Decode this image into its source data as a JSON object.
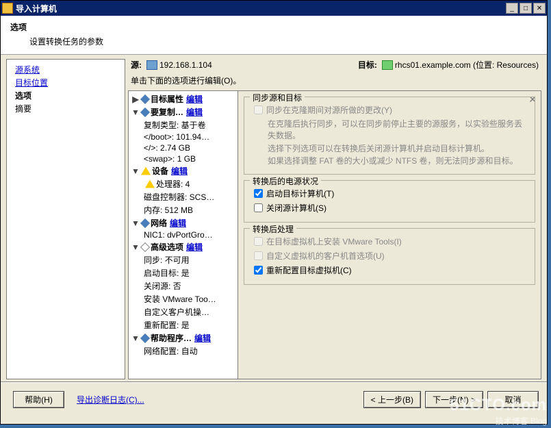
{
  "window": {
    "title": "导入计算机"
  },
  "header": {
    "title": "选项",
    "subtitle": "设置转换任务的参数"
  },
  "nav": {
    "items": [
      {
        "label": "源系统",
        "kind": "link"
      },
      {
        "label": "目标位置",
        "kind": "link"
      },
      {
        "label": "选项",
        "kind": "current"
      },
      {
        "label": "摘要",
        "kind": "text"
      }
    ]
  },
  "srcdst": {
    "source_label": "源:",
    "source_value": "192.168.1.104",
    "dest_label": "目标:",
    "dest_value": "rhcs01.example.com (位置: Resources)"
  },
  "instruct": "单击下面的选项进行编辑(O)。",
  "tree": {
    "edit_label": "编辑",
    "sections": [
      {
        "type": "header",
        "expander": "▶",
        "diamond": "fill",
        "label": "目标属性",
        "edit": true
      },
      {
        "type": "header",
        "expander": "▼",
        "diamond": "fill",
        "label": "要复制…",
        "edit": true
      },
      {
        "type": "sub",
        "label": "复制类型: 基于卷"
      },
      {
        "type": "sub",
        "label": "</boot>: 101.94…"
      },
      {
        "type": "sub",
        "label": "</>: 2.74 GB"
      },
      {
        "type": "sub",
        "label": "<swap>: 1 GB"
      },
      {
        "type": "header",
        "expander": "▼",
        "warn": true,
        "label": "设备",
        "edit": true
      },
      {
        "type": "sub",
        "warn": true,
        "label": "处理器: 4"
      },
      {
        "type": "sub",
        "label": "磁盘控制器: SCS…"
      },
      {
        "type": "sub",
        "label": "内存: 512 MB"
      },
      {
        "type": "header",
        "expander": "▼",
        "diamond": "fill",
        "label": "网络",
        "edit": true
      },
      {
        "type": "sub",
        "label": "NIC1: dvPortGro…"
      },
      {
        "type": "header",
        "expander": "▼",
        "diamond": "empty",
        "label": "高级选项",
        "edit": true
      },
      {
        "type": "sub",
        "label": "同步: 不可用"
      },
      {
        "type": "sub",
        "label": "启动目标: 是"
      },
      {
        "type": "sub",
        "label": "关闭源: 否"
      },
      {
        "type": "sub",
        "label": "安装 VMware Too…"
      },
      {
        "type": "sub",
        "label": "自定义客户机操…"
      },
      {
        "type": "sub",
        "label": "重新配置: 是"
      },
      {
        "type": "header",
        "expander": "▼",
        "diamond": "fill",
        "label": "帮助程序…",
        "edit": true
      },
      {
        "type": "sub",
        "label": "网络配置: 自动"
      }
    ]
  },
  "options": {
    "sync": {
      "legend": "同步源和目标",
      "cb_label": "同步在克隆期间对源所做的更改(Y)",
      "cb_checked": false,
      "cb_disabled": true,
      "help1": "在克隆后执行同步，可以在同步前停止主要的源服务，以实验些服务丢失数据。",
      "help2": "选择下列选项可以在转换后关闭源计算机并启动目标计算机。",
      "help3": "如果选择调整 FAT 卷的大小或减少 NTFS 卷，则无法同步源和目标。"
    },
    "power": {
      "legend": "转换后的电源状况",
      "start_target": "启动目标计算机(T)",
      "start_target_checked": true,
      "shutdown_source": "关闭源计算机(S)",
      "shutdown_source_checked": false
    },
    "post": {
      "legend": "转换后处理",
      "install_tools": "在目标虚拟机上安装 VMware Tools(I)",
      "install_tools_checked": false,
      "install_tools_disabled": true,
      "customize": "自定义虚拟机的客户机首选项(U)",
      "customize_checked": false,
      "customize_disabled": true,
      "reconfig": "重新配置目标虚拟机(C)",
      "reconfig_checked": true
    }
  },
  "footer": {
    "help": "帮助(H)",
    "export": "导出诊断日志(C)...",
    "back": "< 上一步(B)",
    "next": "下一步(N) >",
    "cancel": "取消"
  },
  "watermark": {
    "big": "51CTO.com",
    "small": "技术博客 Blog"
  }
}
